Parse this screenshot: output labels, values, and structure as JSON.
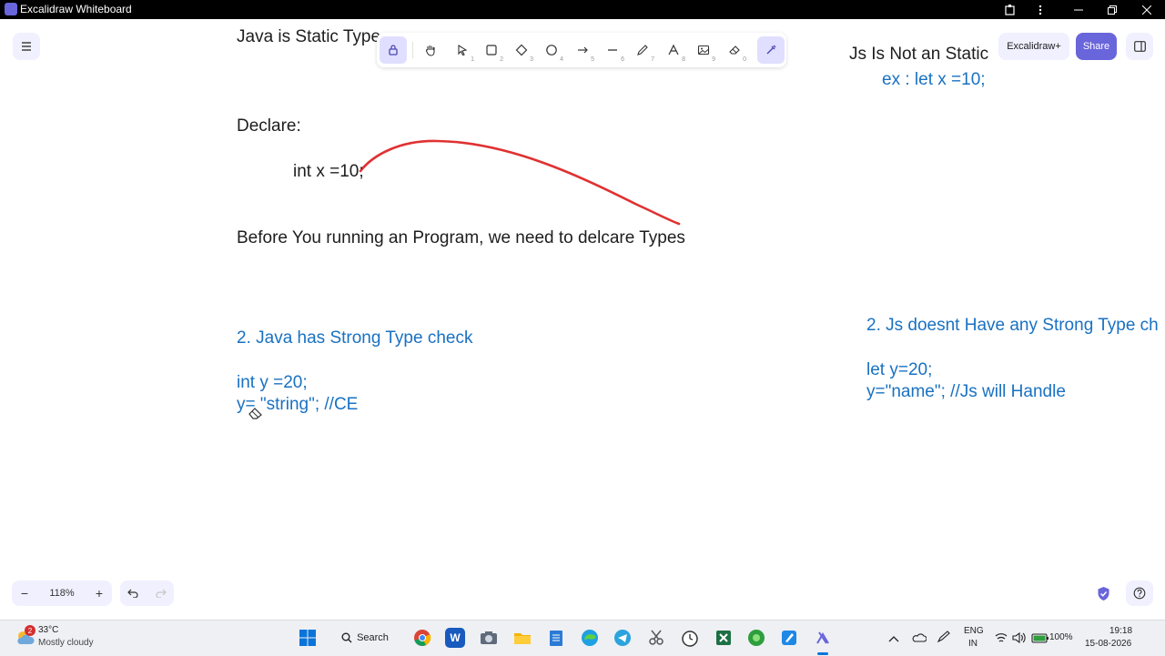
{
  "window": {
    "title": "Excalidraw Whiteboard"
  },
  "toolbar": {
    "tools": [
      {
        "name": "lock",
        "num": ""
      },
      {
        "name": "hand",
        "num": ""
      },
      {
        "name": "selection",
        "num": "1"
      },
      {
        "name": "rectangle",
        "num": "2"
      },
      {
        "name": "diamond",
        "num": "3"
      },
      {
        "name": "ellipse",
        "num": "4"
      },
      {
        "name": "arrow",
        "num": "5"
      },
      {
        "name": "line",
        "num": "6"
      },
      {
        "name": "draw",
        "num": "7"
      },
      {
        "name": "text",
        "num": "8"
      },
      {
        "name": "image",
        "num": "9"
      },
      {
        "name": "eraser",
        "num": "0"
      },
      {
        "name": "laser",
        "num": ""
      }
    ]
  },
  "header": {
    "excalidraw_plus": "Excalidraw+",
    "share": "Share"
  },
  "canvas": {
    "java_title": "Java is Static Type",
    "declare": "Declare:",
    "int_x": "int x =10;",
    "before": "Before You running an Program, we need to delcare Types",
    "java_strong": "2. Java has Strong Type check",
    "int_y": "int y =20;",
    "y_string": "y= \"string\"; //CE",
    "js_title": "Js Is Not an Static",
    "js_example": "ex :  let x =10;",
    "js_strong": "2. Js  doesnt Have any Strong Type ch",
    "let_y": "let y=20;",
    "y_name": "y=\"name\";  //Js will Handle"
  },
  "zoom": {
    "minus": "−",
    "level": "118%",
    "plus": "+"
  },
  "taskbar": {
    "weather_badge": "2",
    "temperature": "33°C",
    "condition": "Mostly cloudy",
    "search": "Search",
    "language_top": "ENG",
    "language_bottom": "IN",
    "battery": "100%",
    "time": "19:18",
    "date": "15-08-2026"
  },
  "colors": {
    "accent": "#6965db",
    "blue_text": "#1971c2",
    "red_stroke": "#e03131"
  }
}
